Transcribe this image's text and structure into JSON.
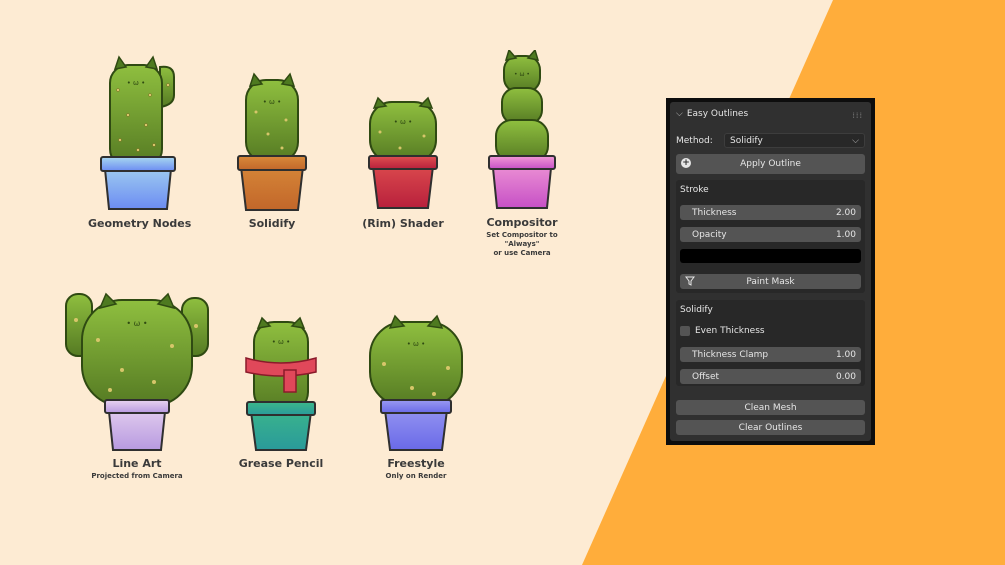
{
  "cacti": [
    {
      "label": "Geometry Nodes",
      "sub": ""
    },
    {
      "label": "Solidify",
      "sub": ""
    },
    {
      "label": "(Rim) Shader",
      "sub": ""
    },
    {
      "label": "Compositor",
      "sub": "Set Compositor to \"Always\"\nor use Camera"
    },
    {
      "label": "Line Art",
      "sub": "Projected from Camera"
    },
    {
      "label": "Grease Pencil",
      "sub": ""
    },
    {
      "label": "Freestyle",
      "sub": "Only on Render"
    }
  ],
  "panel": {
    "title": "Easy Outlines",
    "method_label": "Method:",
    "method_value": "Solidify",
    "apply_button": "Apply Outline",
    "stroke": {
      "title": "Stroke",
      "thickness_label": "Thickness",
      "thickness_value": "2.00",
      "opacity_label": "Opacity",
      "opacity_value": "1.00",
      "color": "#000000",
      "paint_mask_button": "Paint Mask"
    },
    "solidify": {
      "title": "Solidify",
      "even_thickness_label": "Even Thickness",
      "thickness_clamp_label": "Thickness Clamp",
      "thickness_clamp_value": "1.00",
      "offset_label": "Offset",
      "offset_value": "0.00"
    },
    "clean_mesh_button": "Clean Mesh",
    "clear_outlines_button": "Clear Outlines"
  },
  "colors": {
    "background": "#fdebd3",
    "accent_orange": "#ffad3b",
    "panel_bg": "#303030"
  },
  "icons": [
    "chevron-down-icon",
    "plus-circle-icon",
    "funnel-icon",
    "grip-icon"
  ]
}
